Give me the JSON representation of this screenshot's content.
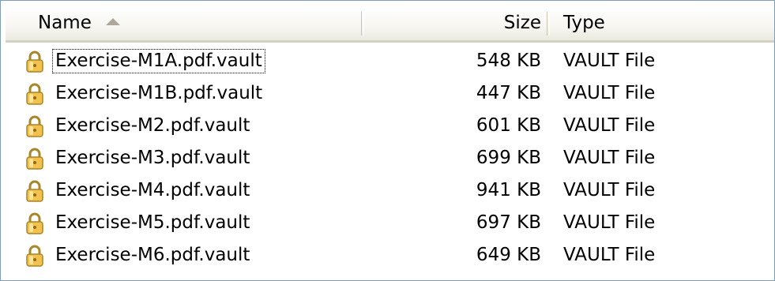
{
  "columns": {
    "name": "Name",
    "size": "Size",
    "type": "Type"
  },
  "sort": {
    "column": "Name",
    "direction": "ascending"
  },
  "files": [
    {
      "name": "Exercise-M1A.pdf.vault",
      "size": "548 KB",
      "type": "VAULT File",
      "icon": "lock-icon"
    },
    {
      "name": "Exercise-M1B.pdf.vault",
      "size": "447 KB",
      "type": "VAULT File",
      "icon": "lock-icon"
    },
    {
      "name": "Exercise-M2.pdf.vault",
      "size": "601 KB",
      "type": "VAULT File",
      "icon": "lock-icon"
    },
    {
      "name": "Exercise-M3.pdf.vault",
      "size": "699 KB",
      "type": "VAULT File",
      "icon": "lock-icon"
    },
    {
      "name": "Exercise-M4.pdf.vault",
      "size": "941 KB",
      "type": "VAULT File",
      "icon": "lock-icon"
    },
    {
      "name": "Exercise-M5.pdf.vault",
      "size": "697 KB",
      "type": "VAULT File",
      "icon": "lock-icon"
    },
    {
      "name": "Exercise-M6.pdf.vault",
      "size": "649 KB",
      "type": "VAULT File",
      "icon": "lock-icon"
    }
  ],
  "colors": {
    "border": "#7f9db9",
    "lock_body": "#f2c14e",
    "lock_shackle": "#a8862a"
  }
}
